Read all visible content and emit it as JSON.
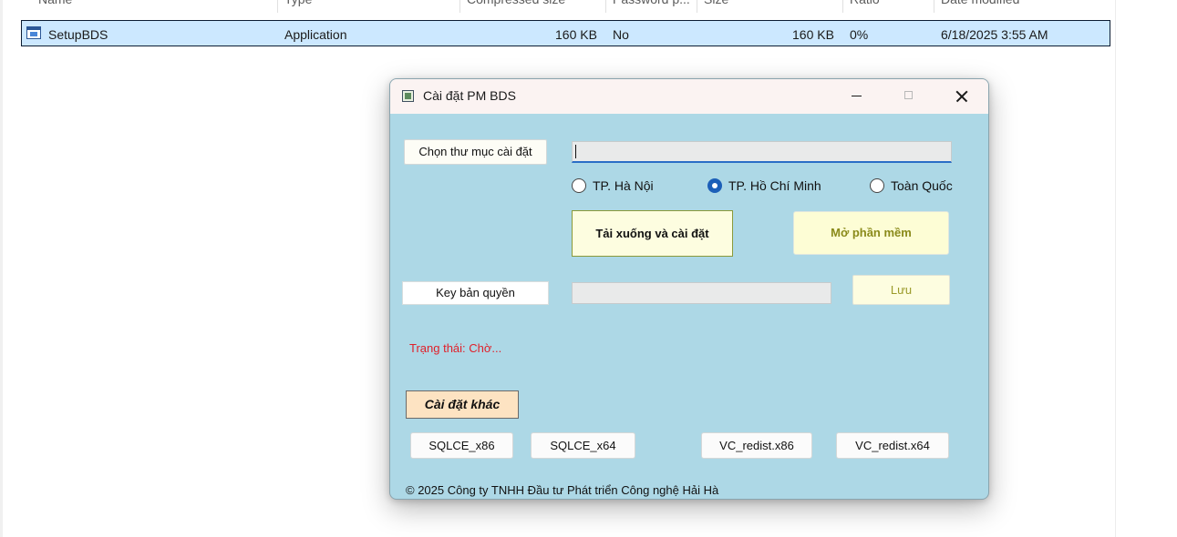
{
  "explorer": {
    "columns": [
      "Name",
      "Type",
      "Compressed size",
      "Password p...",
      "Size",
      "Ratio",
      "Date modified"
    ],
    "row": {
      "name": "SetupBDS",
      "type": "Application",
      "compressed_size": "160 KB",
      "password": "No",
      "size": "160 KB",
      "ratio": "0%",
      "date_modified": "6/18/2025 3:55 AM"
    }
  },
  "dialog": {
    "title": "Cài đặt PM BDS",
    "choose_folder_label": "Chọn thư mục cài đặt",
    "path_value": "",
    "regions": [
      {
        "label": "TP. Hà Nội",
        "selected": false
      },
      {
        "label": "TP. Hồ Chí Minh",
        "selected": true
      },
      {
        "label": "Toàn Quốc",
        "selected": false
      }
    ],
    "download_install_label": "Tải xuống và cài đặt",
    "open_software_label": "Mở phần mềm",
    "license_key_label": "Key bản quyền",
    "license_key_value": "",
    "save_label": "Lưu",
    "status_text": "Trạng thái: Chờ...",
    "other_install_label": "Cài đặt khác",
    "components": [
      "SQLCE_x86",
      "SQLCE_x64",
      "VC_redist.x86",
      "VC_redist.x64"
    ],
    "copyright": "© 2025 Công ty TNHH Đầu tư Phát triển Công nghệ Hải Hà"
  },
  "colors": {
    "dialog_bg": "#add8e6",
    "status_red": "#e0202a",
    "radio_accent": "#1c5fb8",
    "selection_bg": "#cce8ff"
  }
}
